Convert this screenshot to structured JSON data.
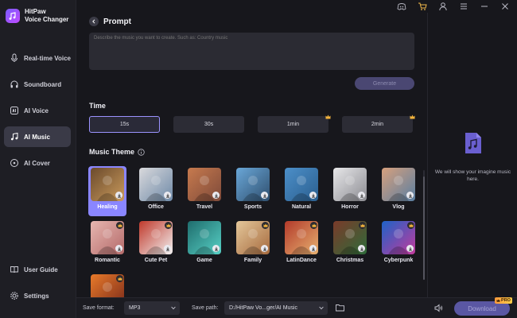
{
  "app": {
    "name": "HitPaw\nVoice Changer",
    "accent": "#8a86ff",
    "background": "#17171c"
  },
  "sidebar": {
    "items": [
      {
        "label": "Real-time Voice",
        "icon": "microphone-icon"
      },
      {
        "label": "Soundboard",
        "icon": "headphones-icon"
      },
      {
        "label": "AI Voice",
        "icon": "ai-voice-icon"
      },
      {
        "label": "AI Music",
        "icon": "music-note-icon",
        "active": true
      },
      {
        "label": "AI Cover",
        "icon": "ai-cover-icon"
      }
    ],
    "bottom_items": [
      {
        "label": "User Guide",
        "icon": "book-icon"
      },
      {
        "label": "Settings",
        "icon": "gear-icon"
      }
    ]
  },
  "topbar": {
    "icons": [
      "discord-icon",
      "cart-icon",
      "user-icon",
      "menu-icon",
      "minimize-icon",
      "close-icon"
    ]
  },
  "prompt": {
    "title": "Prompt",
    "placeholder": "Describe the music you want to create. Such as: Country music",
    "generate_label": "Generate"
  },
  "time": {
    "title": "Time",
    "options": [
      {
        "label": "15s",
        "selected": true,
        "premium": false
      },
      {
        "label": "30s",
        "selected": false,
        "premium": false
      },
      {
        "label": "1min",
        "selected": false,
        "premium": true
      },
      {
        "label": "2min",
        "selected": false,
        "premium": true
      }
    ]
  },
  "music_theme": {
    "title": "Music Theme",
    "themes": [
      {
        "label": "Healing",
        "selected": true,
        "premium": false,
        "colors": [
          "#6b4a2c",
          "#c99a5c"
        ]
      },
      {
        "label": "Office",
        "selected": false,
        "premium": false,
        "colors": [
          "#d9d9dc",
          "#6f8aa8"
        ]
      },
      {
        "label": "Travel",
        "selected": false,
        "premium": false,
        "colors": [
          "#c77a4e",
          "#7e4a3a"
        ]
      },
      {
        "label": "Sports",
        "selected": false,
        "premium": false,
        "colors": [
          "#6aa7d8",
          "#2f4f6e"
        ]
      },
      {
        "label": "Natural",
        "selected": false,
        "premium": false,
        "colors": [
          "#4c8fc9",
          "#2b5f8f"
        ]
      },
      {
        "label": "Horror",
        "selected": false,
        "premium": false,
        "colors": [
          "#e8e8ea",
          "#8c8c92"
        ]
      },
      {
        "label": "Vlog",
        "selected": false,
        "premium": false,
        "colors": [
          "#d7a07d",
          "#5a7fa2"
        ]
      },
      {
        "label": "Romantic",
        "selected": false,
        "premium": true,
        "colors": [
          "#e7b6b0",
          "#b46a6a"
        ]
      },
      {
        "label": "Cute Pet",
        "selected": false,
        "premium": true,
        "colors": [
          "#c0392b",
          "#f2f2f2"
        ]
      },
      {
        "label": "Game",
        "selected": false,
        "premium": false,
        "colors": [
          "#1f6d6d",
          "#57d0c5"
        ]
      },
      {
        "label": "Family",
        "selected": false,
        "premium": true,
        "colors": [
          "#e4c79a",
          "#a66a3e"
        ]
      },
      {
        "label": "LatinDance",
        "selected": false,
        "premium": true,
        "colors": [
          "#b33a2a",
          "#e6b070"
        ]
      },
      {
        "label": "Christmas",
        "selected": false,
        "premium": true,
        "colors": [
          "#7a3a2a",
          "#2e6b3a"
        ]
      },
      {
        "label": "Cyberpunk",
        "selected": false,
        "premium": true,
        "colors": [
          "#1e63c8",
          "#c23a9c"
        ]
      },
      {
        "label": "",
        "selected": false,
        "premium": true,
        "colors": [
          "#e87a2a",
          "#7a2a1a"
        ]
      }
    ]
  },
  "right_panel": {
    "message": "We will show your imagine music here."
  },
  "bottombar": {
    "save_format_label": "Save format:",
    "save_format_value": "MP3",
    "save_path_label": "Save path:",
    "save_path_value": "D:/HitPaw Vo...ger/AI Music",
    "download_label": "Download",
    "pro_label": "PRO"
  }
}
